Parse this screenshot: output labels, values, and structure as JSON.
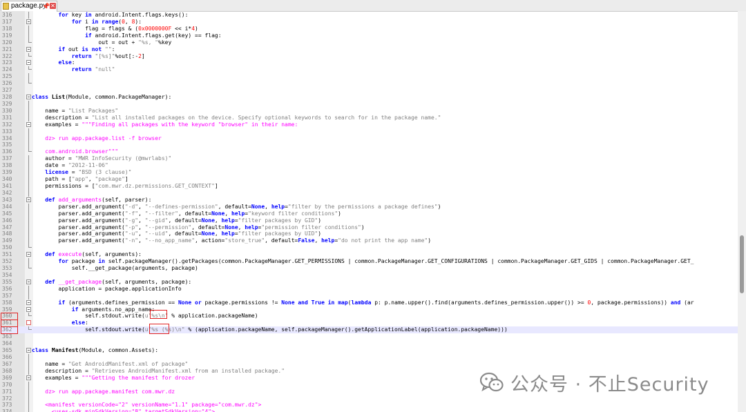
{
  "tab": {
    "filename": "package.py",
    "pin_glyph": "📌",
    "close_glyph": "✕"
  },
  "lines": [
    {
      "n": "316",
      "fold": "vline",
      "tokens": [
        [
          "        ",
          ""
        ],
        [
          "for",
          "kw"
        ],
        [
          " key ",
          ""
        ],
        [
          "in",
          "kw"
        ],
        [
          " android.Intent.flags.keys():",
          ""
        ]
      ]
    },
    {
      "n": "317",
      "fold": "box",
      "tokens": [
        [
          "            ",
          ""
        ],
        [
          "for",
          "kw"
        ],
        [
          " i ",
          ""
        ],
        [
          "in",
          "kw"
        ],
        [
          " ",
          ""
        ],
        [
          "range",
          "kw"
        ],
        [
          "(",
          ""
        ],
        [
          "0",
          "nm"
        ],
        [
          ", ",
          ""
        ],
        [
          "8",
          "nm"
        ],
        [
          "):",
          ""
        ]
      ]
    },
    {
      "n": "318",
      "fold": "vline",
      "tokens": [
        [
          "                flag = flags & (",
          ""
        ],
        [
          "0x0000000F",
          "nm"
        ],
        [
          " << i*",
          ""
        ],
        [
          "4",
          "nm"
        ],
        [
          ")",
          ""
        ]
      ]
    },
    {
      "n": "319",
      "fold": "vline",
      "tokens": [
        [
          "                ",
          ""
        ],
        [
          "if",
          "kw"
        ],
        [
          " android.Intent.flags.get(key) == flag:",
          ""
        ]
      ]
    },
    {
      "n": "320",
      "fold": "lend",
      "tokens": [
        [
          "                    out = out + ",
          ""
        ],
        [
          "\"%s, \"",
          "st"
        ],
        [
          "%key",
          ""
        ]
      ]
    },
    {
      "n": "321",
      "fold": "box",
      "tokens": [
        [
          "        ",
          ""
        ],
        [
          "if",
          "kw"
        ],
        [
          " out ",
          ""
        ],
        [
          "is not",
          "kw"
        ],
        [
          " ",
          ""
        ],
        [
          "\"\"",
          "st"
        ],
        [
          ":",
          ""
        ]
      ]
    },
    {
      "n": "322",
      "fold": "lend",
      "tokens": [
        [
          "            ",
          ""
        ],
        [
          "return",
          "kw"
        ],
        [
          " ",
          ""
        ],
        [
          "\"[%s]\"",
          "st"
        ],
        [
          "%out[:-",
          ""
        ],
        [
          "2",
          "nm"
        ],
        [
          "]",
          ""
        ]
      ]
    },
    {
      "n": "323",
      "fold": "box",
      "tokens": [
        [
          "        ",
          ""
        ],
        [
          "else",
          "kw"
        ],
        [
          ":",
          ""
        ]
      ]
    },
    {
      "n": "324",
      "fold": "lend",
      "tokens": [
        [
          "            ",
          ""
        ],
        [
          "return",
          "kw"
        ],
        [
          " ",
          ""
        ],
        [
          "\"null\"",
          "st"
        ]
      ]
    },
    {
      "n": "325",
      "fold": "vline",
      "tokens": []
    },
    {
      "n": "326",
      "fold": "lend",
      "tokens": []
    },
    {
      "n": "327",
      "fold": "",
      "tokens": []
    },
    {
      "n": "328",
      "fold": "box",
      "tokens": [
        [
          "class",
          "kw"
        ],
        [
          " ",
          ""
        ],
        [
          "List",
          "cls"
        ],
        [
          "(Module, common.PackageManager):",
          ""
        ]
      ]
    },
    {
      "n": "329",
      "fold": "vline",
      "tokens": []
    },
    {
      "n": "330",
      "fold": "vline",
      "tokens": [
        [
          "    name = ",
          ""
        ],
        [
          "\"List Packages\"",
          "st"
        ]
      ]
    },
    {
      "n": "331",
      "fold": "vline",
      "tokens": [
        [
          "    description = ",
          ""
        ],
        [
          "\"List all installed packages on the device. Specify optional keywords to search for in the package name.\"",
          "st"
        ]
      ]
    },
    {
      "n": "332",
      "fold": "box",
      "tokens": [
        [
          "    examples = ",
          ""
        ],
        [
          "\"\"\"Finding all packages with the keyword \"browser\" in their name:",
          "fn"
        ]
      ]
    },
    {
      "n": "333",
      "fold": "vline",
      "tokens": []
    },
    {
      "n": "334",
      "fold": "vline",
      "tokens": [
        [
          "    dz> run app.package.list -f browser",
          "fn"
        ]
      ]
    },
    {
      "n": "335",
      "fold": "vline",
      "tokens": []
    },
    {
      "n": "336",
      "fold": "lend",
      "tokens": [
        [
          "    com.android.browser\"\"\"",
          "fn"
        ]
      ]
    },
    {
      "n": "337",
      "fold": "vline",
      "tokens": [
        [
          "    author = ",
          ""
        ],
        [
          "\"MWR InfoSecurity (@mwrlabs)\"",
          "st"
        ]
      ]
    },
    {
      "n": "338",
      "fold": "vline",
      "tokens": [
        [
          "    date = ",
          ""
        ],
        [
          "\"2012-11-06\"",
          "st"
        ]
      ]
    },
    {
      "n": "339",
      "fold": "vline",
      "tokens": [
        [
          "    ",
          ""
        ],
        [
          "license",
          "kw"
        ],
        [
          " = ",
          ""
        ],
        [
          "\"BSD (3 clause)\"",
          "st"
        ]
      ]
    },
    {
      "n": "340",
      "fold": "vline",
      "tokens": [
        [
          "    path = [",
          ""
        ],
        [
          "\"app\"",
          "st"
        ],
        [
          ", ",
          ""
        ],
        [
          "\"package\"",
          "st"
        ],
        [
          "]",
          ""
        ]
      ]
    },
    {
      "n": "341",
      "fold": "vline",
      "tokens": [
        [
          "    permissions = [",
          ""
        ],
        [
          "\"com.mwr.dz.permissions.GET_CONTEXT\"",
          "st"
        ],
        [
          "]",
          ""
        ]
      ]
    },
    {
      "n": "342",
      "fold": "vline",
      "tokens": []
    },
    {
      "n": "343",
      "fold": "box",
      "tokens": [
        [
          "    ",
          ""
        ],
        [
          "def",
          "kw"
        ],
        [
          " ",
          ""
        ],
        [
          "add_arguments",
          "fn"
        ],
        [
          "(self, parser):",
          ""
        ]
      ]
    },
    {
      "n": "344",
      "fold": "vline",
      "tokens": [
        [
          "        parser.add_argument(",
          ""
        ],
        [
          "\"-d\"",
          "st"
        ],
        [
          ", ",
          ""
        ],
        [
          "\"--defines-permission\"",
          "st"
        ],
        [
          ", default=",
          ""
        ],
        [
          "None",
          "kw"
        ],
        [
          ", ",
          ""
        ],
        [
          "help",
          "kw"
        ],
        [
          "=",
          ""
        ],
        [
          "\"filter by the permissions a package defines\"",
          "st"
        ],
        [
          ")",
          ""
        ]
      ]
    },
    {
      "n": "345",
      "fold": "vline",
      "tokens": [
        [
          "        parser.add_argument(",
          ""
        ],
        [
          "\"-f\"",
          "st"
        ],
        [
          ", ",
          ""
        ],
        [
          "\"--filter\"",
          "st"
        ],
        [
          ", default=",
          ""
        ],
        [
          "None",
          "kw"
        ],
        [
          ", ",
          ""
        ],
        [
          "help",
          "kw"
        ],
        [
          "=",
          ""
        ],
        [
          "\"keyword filter conditions\"",
          "st"
        ],
        [
          ")",
          ""
        ]
      ]
    },
    {
      "n": "346",
      "fold": "vline",
      "tokens": [
        [
          "        parser.add_argument(",
          ""
        ],
        [
          "\"-g\"",
          "st"
        ],
        [
          ", ",
          ""
        ],
        [
          "\"--gid\"",
          "st"
        ],
        [
          ", default=",
          ""
        ],
        [
          "None",
          "kw"
        ],
        [
          ", ",
          ""
        ],
        [
          "help",
          "kw"
        ],
        [
          "=",
          ""
        ],
        [
          "\"filter packages by GID\"",
          "st"
        ],
        [
          ")",
          ""
        ]
      ]
    },
    {
      "n": "347",
      "fold": "vline",
      "tokens": [
        [
          "        parser.add_argument(",
          ""
        ],
        [
          "\"-p\"",
          "st"
        ],
        [
          ", ",
          ""
        ],
        [
          "\"--permission\"",
          "st"
        ],
        [
          ", default=",
          ""
        ],
        [
          "None",
          "kw"
        ],
        [
          ", ",
          ""
        ],
        [
          "help",
          "kw"
        ],
        [
          "=",
          ""
        ],
        [
          "\"permission filter conditions\"",
          "st"
        ],
        [
          ")",
          ""
        ]
      ]
    },
    {
      "n": "348",
      "fold": "vline",
      "tokens": [
        [
          "        parser.add_argument(",
          ""
        ],
        [
          "\"-u\"",
          "st"
        ],
        [
          ", ",
          ""
        ],
        [
          "\"--uid\"",
          "st"
        ],
        [
          ", default=",
          ""
        ],
        [
          "None",
          "kw"
        ],
        [
          ", ",
          ""
        ],
        [
          "help",
          "kw"
        ],
        [
          "=",
          ""
        ],
        [
          "\"filter packages by UID\"",
          "st"
        ],
        [
          ")",
          ""
        ]
      ]
    },
    {
      "n": "349",
      "fold": "vline",
      "tokens": [
        [
          "        parser.add_argument(",
          ""
        ],
        [
          "\"-n\"",
          "st"
        ],
        [
          ", ",
          ""
        ],
        [
          "\"--no_app_name\"",
          "st"
        ],
        [
          ", action=",
          ""
        ],
        [
          "\"store_true\"",
          "st"
        ],
        [
          ", default=",
          ""
        ],
        [
          "False",
          "kw"
        ],
        [
          ", ",
          ""
        ],
        [
          "help",
          "kw"
        ],
        [
          "=",
          ""
        ],
        [
          "\"do not print the app name\"",
          "st"
        ],
        [
          ")",
          ""
        ]
      ]
    },
    {
      "n": "350",
      "fold": "lend",
      "tokens": []
    },
    {
      "n": "351",
      "fold": "box",
      "tokens": [
        [
          "    ",
          ""
        ],
        [
          "def",
          "kw"
        ],
        [
          " ",
          ""
        ],
        [
          "execute",
          "fn"
        ],
        [
          "(self, arguments):",
          ""
        ]
      ]
    },
    {
      "n": "352",
      "fold": "vline",
      "tokens": [
        [
          "        ",
          ""
        ],
        [
          "for",
          "kw"
        ],
        [
          " package ",
          ""
        ],
        [
          "in",
          "kw"
        ],
        [
          " self.packageManager().getPackages(common.PackageManager.GET_PERMISSIONS | common.PackageManager.GET_CONFIGURATIONS | common.PackageManager.GET_GIDS | common.PackageManager.GET_",
          ""
        ]
      ]
    },
    {
      "n": "353",
      "fold": "lend",
      "tokens": [
        [
          "            self.__get_package(arguments, package)",
          ""
        ]
      ]
    },
    {
      "n": "354",
      "fold": "",
      "tokens": []
    },
    {
      "n": "355",
      "fold": "box",
      "tokens": [
        [
          "    ",
          ""
        ],
        [
          "def",
          "kw"
        ],
        [
          " ",
          ""
        ],
        [
          "__get_package",
          "fn"
        ],
        [
          "(self, arguments, package):",
          ""
        ]
      ]
    },
    {
      "n": "356",
      "fold": "vline",
      "tokens": [
        [
          "        application = package.applicationInfo",
          ""
        ]
      ]
    },
    {
      "n": "357",
      "fold": "vline",
      "tokens": []
    },
    {
      "n": "358",
      "fold": "box",
      "tokens": [
        [
          "        ",
          ""
        ],
        [
          "if",
          "kw"
        ],
        [
          " (arguments.defines_permission == ",
          ""
        ],
        [
          "None",
          "kw"
        ],
        [
          " ",
          ""
        ],
        [
          "or",
          "kw"
        ],
        [
          " package.permissions != ",
          ""
        ],
        [
          "None",
          "kw"
        ],
        [
          " ",
          ""
        ],
        [
          "and",
          "kw"
        ],
        [
          " ",
          ""
        ],
        [
          "True",
          "kw"
        ],
        [
          " ",
          ""
        ],
        [
          "in",
          "kw"
        ],
        [
          " ",
          ""
        ],
        [
          "map",
          "kw"
        ],
        [
          "(",
          ""
        ],
        [
          "lambda",
          "kw"
        ],
        [
          " p: p.name.upper().find(arguments.defines_permission.upper()) >= ",
          ""
        ],
        [
          "0",
          "nm"
        ],
        [
          ", package.permissions)) ",
          ""
        ],
        [
          "and",
          "kw"
        ],
        [
          " (ar",
          ""
        ]
      ]
    },
    {
      "n": "359",
      "fold": "box",
      "tokens": [
        [
          "            ",
          ""
        ],
        [
          "if",
          "kw"
        ],
        [
          " arguments.no_app_name:",
          ""
        ]
      ]
    },
    {
      "n": "360",
      "fold": "lend",
      "red": true,
      "tokens": [
        [
          "                self.stdout.write(",
          ""
        ],
        [
          "u\"%s\\n\"",
          "st"
        ],
        [
          " % application.packageName)",
          ""
        ]
      ]
    },
    {
      "n": "361",
      "fold": "redbox",
      "red": true,
      "tokens": [
        [
          "            ",
          ""
        ],
        [
          "else",
          "kw"
        ],
        [
          ":",
          ""
        ]
      ]
    },
    {
      "n": "362",
      "fold": "lend",
      "red": true,
      "hl": true,
      "tokens": [
        [
          "                self.stdout.write(",
          ""
        ],
        [
          "u\"%s (%s)\\n\"",
          "st"
        ],
        [
          " % (application.packageName, self.packageManager().getApplicationLabel(application.packageName)))",
          ""
        ]
      ]
    },
    {
      "n": "363",
      "fold": "",
      "tokens": []
    },
    {
      "n": "364",
      "fold": "",
      "tokens": []
    },
    {
      "n": "365",
      "fold": "box",
      "tokens": [
        [
          "class",
          "kw"
        ],
        [
          " ",
          ""
        ],
        [
          "Manifest",
          "cls"
        ],
        [
          "(Module, common.Assets):",
          ""
        ]
      ]
    },
    {
      "n": "366",
      "fold": "vline",
      "tokens": []
    },
    {
      "n": "367",
      "fold": "vline",
      "tokens": [
        [
          "    name = ",
          ""
        ],
        [
          "\"Get AndroidManifest.xml of package\"",
          "st"
        ]
      ]
    },
    {
      "n": "368",
      "fold": "vline",
      "tokens": [
        [
          "    description = ",
          ""
        ],
        [
          "\"Retrieves AndroidManifest.xml from an installed package.\"",
          "st"
        ]
      ]
    },
    {
      "n": "369",
      "fold": "box",
      "tokens": [
        [
          "    examples = ",
          ""
        ],
        [
          "\"\"\"Getting the manifest for drozer",
          "fn"
        ]
      ]
    },
    {
      "n": "370",
      "fold": "vline",
      "tokens": []
    },
    {
      "n": "371",
      "fold": "vline",
      "tokens": [
        [
          "    dz> run app.package.manifest com.mwr.dz",
          "fn"
        ]
      ]
    },
    {
      "n": "372",
      "fold": "vline",
      "tokens": []
    },
    {
      "n": "373",
      "fold": "vline",
      "tokens": [
        [
          "    <manifest versionCode=\"2\" versionName=\"1.1\" package=\"com.mwr.dz\">",
          "fn"
        ]
      ]
    },
    {
      "n": "374",
      "fold": "vline",
      "tokens": [
        [
          "      <uses-sdk minSdkVersion=\"8\" targetSdkVersion=\"4\">",
          "fn"
        ]
      ]
    }
  ],
  "watermark": {
    "text": "公众号 · 不止Security"
  },
  "colors": {
    "keyword": "#0000ff",
    "string": "#808080",
    "number": "#ff0000",
    "function": "#ff00ff",
    "highlight": "#e8e8ff",
    "annotation": "#e02020"
  }
}
